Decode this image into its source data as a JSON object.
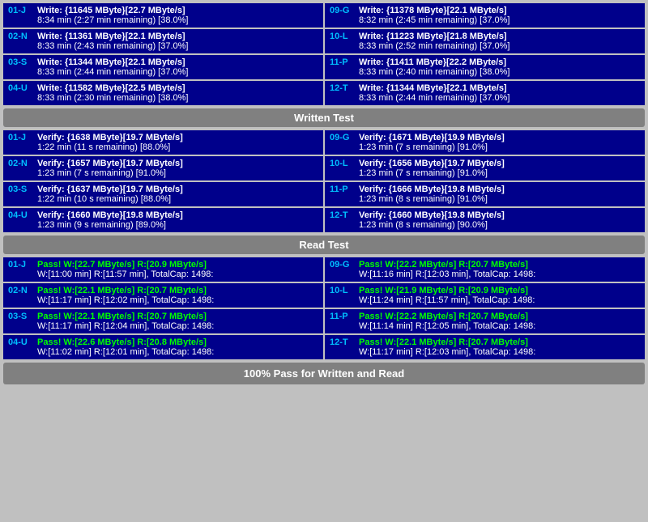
{
  "sections": {
    "write_test": {
      "label": "Written Test",
      "rows_left": [
        {
          "id": "01-J",
          "line1": "Write: {11645 MByte}[22.7 MByte/s]",
          "line2": "8:34 min (2:27 min remaining)  [38.0%]"
        },
        {
          "id": "02-N",
          "line1": "Write: {11361 MByte}[22.1 MByte/s]",
          "line2": "8:33 min (2:43 min remaining)  [37.0%]"
        },
        {
          "id": "03-S",
          "line1": "Write: {11344 MByte}[22.1 MByte/s]",
          "line2": "8:33 min (2:44 min remaining)  [37.0%]"
        },
        {
          "id": "04-U",
          "line1": "Write: {11582 MByte}[22.5 MByte/s]",
          "line2": "8:33 min (2:30 min remaining)  [38.0%]"
        }
      ],
      "rows_right": [
        {
          "id": "09-G",
          "line1": "Write: {11378 MByte}[22.1 MByte/s]",
          "line2": "8:32 min (2:45 min remaining)  [37.0%]"
        },
        {
          "id": "10-L",
          "line1": "Write: {11223 MByte}[21.8 MByte/s]",
          "line2": "8:33 min (2:52 min remaining)  [37.0%]"
        },
        {
          "id": "11-P",
          "line1": "Write: {11411 MByte}[22.2 MByte/s]",
          "line2": "8:33 min (2:40 min remaining)  [38.0%]"
        },
        {
          "id": "12-T",
          "line1": "Write: {11344 MByte}[22.1 MByte/s]",
          "line2": "8:33 min (2:44 min remaining)  [37.0%]"
        }
      ]
    },
    "verify_test": {
      "label": "Written Test",
      "rows_left": [
        {
          "id": "01-J",
          "line1": "Verify: {1638 MByte}[19.7 MByte/s]",
          "line2": "1:22 min (11 s remaining)  [88.0%]"
        },
        {
          "id": "02-N",
          "line1": "Verify: {1657 MByte}[19.7 MByte/s]",
          "line2": "1:23 min (7 s remaining)  [91.0%]"
        },
        {
          "id": "03-S",
          "line1": "Verify: {1637 MByte}[19.7 MByte/s]",
          "line2": "1:22 min (10 s remaining)  [88.0%]"
        },
        {
          "id": "04-U",
          "line1": "Verify: {1660 MByte}[19.8 MByte/s]",
          "line2": "1:23 min (9 s remaining)  [89.0%]"
        }
      ],
      "rows_right": [
        {
          "id": "09-G",
          "line1": "Verify: {1671 MByte}[19.9 MByte/s]",
          "line2": "1:23 min (7 s remaining)  [91.0%]"
        },
        {
          "id": "10-L",
          "line1": "Verify: {1656 MByte}[19.7 MByte/s]",
          "line2": "1:23 min (7 s remaining)  [91.0%]"
        },
        {
          "id": "11-P",
          "line1": "Verify: {1666 MByte}[19.8 MByte/s]",
          "line2": "1:23 min (8 s remaining)  [91.0%]"
        },
        {
          "id": "12-T",
          "line1": "Verify: {1660 MByte}[19.8 MByte/s]",
          "line2": "1:23 min (8 s remaining)  [90.0%]"
        }
      ]
    },
    "read_test": {
      "label": "Read Test",
      "rows_left": [
        {
          "id": "01-J",
          "line1": "Pass! W:[22.7 MByte/s] R:[20.9 MByte/s]",
          "line2": "W:[11:00 min] R:[11:57 min], TotalCap: 1498:"
        },
        {
          "id": "02-N",
          "line1": "Pass! W:[22.1 MByte/s] R:[20.7 MByte/s]",
          "line2": "W:[11:17 min] R:[12:02 min], TotalCap: 1498:"
        },
        {
          "id": "03-S",
          "line1": "Pass! W:[22.1 MByte/s] R:[20.7 MByte/s]",
          "line2": "W:[11:17 min] R:[12:04 min], TotalCap: 1498:"
        },
        {
          "id": "04-U",
          "line1": "Pass! W:[22.6 MByte/s] R:[20.8 MByte/s]",
          "line2": "W:[11:02 min] R:[12:01 min], TotalCap: 1498:"
        }
      ],
      "rows_right": [
        {
          "id": "09-G",
          "line1": "Pass! W:[22.2 MByte/s] R:[20.7 MByte/s]",
          "line2": "W:[11:16 min] R:[12:03 min], TotalCap: 1498:"
        },
        {
          "id": "10-L",
          "line1": "Pass! W:[21.9 MByte/s] R:[20.9 MByte/s]",
          "line2": "W:[11:24 min] R:[11:57 min], TotalCap: 1498:"
        },
        {
          "id": "11-P",
          "line1": "Pass! W:[22.2 MByte/s] R:[20.7 MByte/s]",
          "line2": "W:[11:14 min] R:[12:05 min], TotalCap: 1498:"
        },
        {
          "id": "12-T",
          "line1": "Pass! W:[22.1 MByte/s] R:[20.7 MByte/s]",
          "line2": "W:[11:17 min] R:[12:03 min], TotalCap: 1498:"
        }
      ]
    }
  },
  "banners": {
    "written_test": "Written Test",
    "read_test": "Read Test",
    "pass_banner": "100% Pass for Written and Read"
  }
}
